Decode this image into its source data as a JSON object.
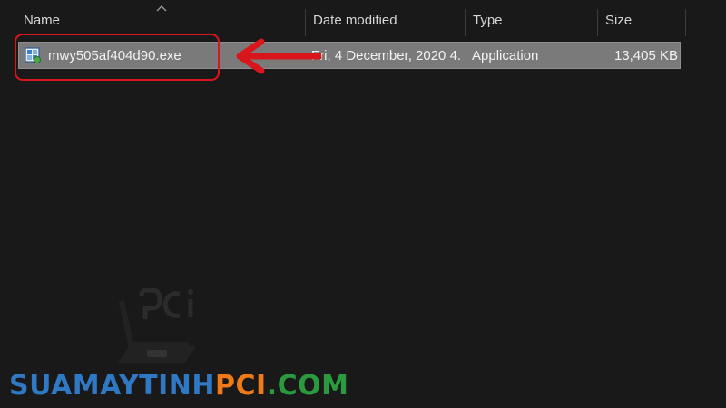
{
  "columns": {
    "name": "Name",
    "date_modified": "Date modified",
    "type": "Type",
    "size": "Size"
  },
  "sort_indicator": "chevron-up-icon",
  "file": {
    "name": "mwy505af404d90.exe",
    "date_modified": "Fri, 4 December, 2020 4...",
    "type": "Application",
    "size": "13,405 KB",
    "icon": "application-exe-icon",
    "selected": true
  },
  "annotation": {
    "highlight_color": "#d9161c",
    "arrow_icon": "arrow-left-icon"
  },
  "watermark": {
    "logo_text": "pci",
    "site_part1": "SUAMAYTINH",
    "site_part2": "PCI",
    "site_part3": ".COM",
    "colors": {
      "part1": "#2f78c4",
      "part2": "#f07a18",
      "part3": "#2b9a3e"
    }
  },
  "colors": {
    "background": "#191919",
    "header_text": "#d6d6d6",
    "selection": "#7a7a7a",
    "row_text": "#f2f2f2"
  }
}
